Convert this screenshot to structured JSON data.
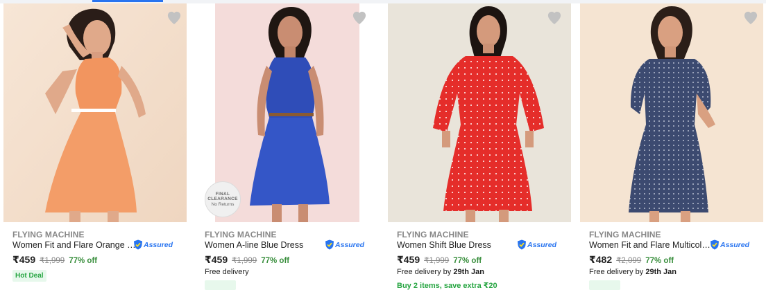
{
  "products": [
    {
      "brand": "FLYING MACHINE",
      "title": "Women Fit and Flare Orange Dre...",
      "assured_label": "Assured",
      "price": "₹459",
      "mrp": "₹1,999",
      "discount": "77% off",
      "badge": "Hot Deal",
      "image_icon": "product-photo-orange-dress"
    },
    {
      "brand": "FLYING MACHINE",
      "title": "Women A-line Blue Dress",
      "assured_label": "Assured",
      "price": "₹459",
      "mrp": "₹1,999",
      "discount": "77% off",
      "delivery_text": "Free delivery",
      "stamp_line1": "FINAL",
      "stamp_line2": "CLEARANCE",
      "stamp_line3": "No Returns",
      "image_icon": "product-photo-blue-dress"
    },
    {
      "brand": "FLYING MACHINE",
      "title": "Women Shift Blue Dress",
      "assured_label": "Assured",
      "price": "₹459",
      "mrp": "₹1,999",
      "discount": "77% off",
      "delivery_text": "Free delivery by",
      "delivery_date": "29th Jan",
      "offer_text": "Buy 2 items, save extra ₹20",
      "image_icon": "product-photo-red-dress"
    },
    {
      "brand": "FLYING MACHINE",
      "title": "Women Fit and Flare Multicolor ...",
      "assured_label": "Assured",
      "price": "₹482",
      "mrp": "₹2,099",
      "discount": "77% off",
      "delivery_text": "Free delivery by",
      "delivery_date": "29th Jan",
      "image_icon": "product-photo-navy-dress"
    }
  ],
  "colors": {
    "accent": "#2874f0",
    "discount_green": "#388e3c",
    "wishlist_heart": "#c2c2c2"
  }
}
